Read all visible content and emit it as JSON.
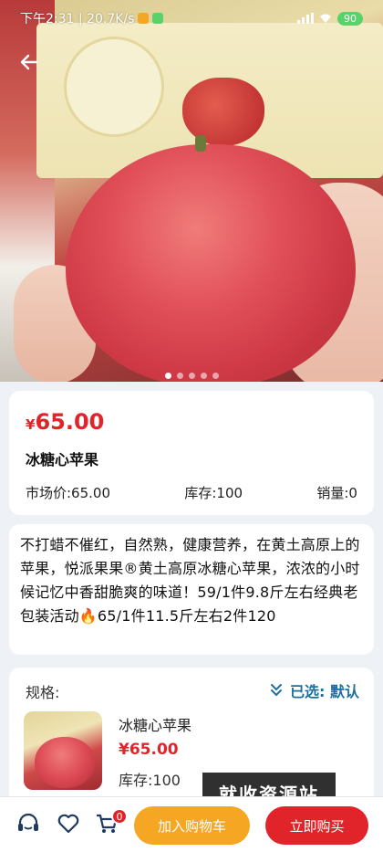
{
  "status_bar": {
    "time": "下午2:31 | 20.7K/s",
    "battery": "90"
  },
  "hero": {
    "image_description": "product-photo-apple",
    "slide_count": 5,
    "active_slide": 1
  },
  "product": {
    "currency_symbol": "¥",
    "price": "65.00",
    "title": "冰糖心苹果",
    "market_price": "市场价:65.00",
    "stock": "库存:100",
    "sales": "销量:0"
  },
  "description": {
    "text": "不打蜡不催红，自然熟，健康营养，在黄土高原上的苹果，悦派果果®黄土高原冰糖心苹果，浓浓的小时候记忆中香甜脆爽的味道！59/1件9.8斤左右经典老包装活动🔥65/1件11.5斤左右2件120"
  },
  "spec": {
    "label": "规格:",
    "selected": "已选:  默认",
    "item_name": "冰糖心苹果",
    "item_price": "¥65.00",
    "item_stock": "库存:100"
  },
  "watermark": "就收资源站",
  "bottom_bar": {
    "cart_count": "0",
    "add_to_cart": "加入购物车",
    "buy_now": "立即购买"
  },
  "colors": {
    "price_red": "#e0242a",
    "cart_orange": "#f5a623",
    "selected_blue": "#1d6fa0"
  }
}
